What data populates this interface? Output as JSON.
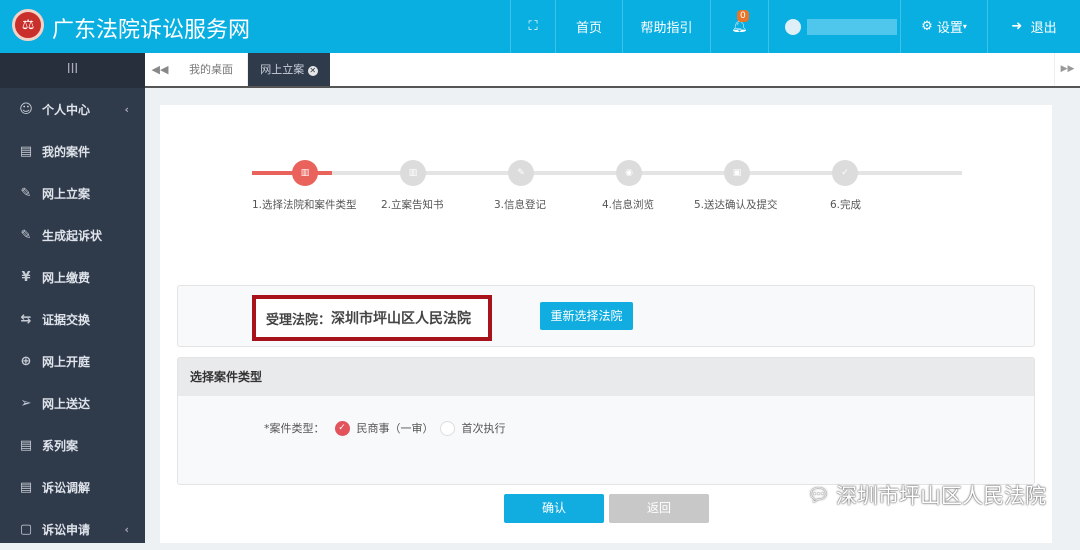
{
  "header": {
    "title": "广东法院诉讼服务网",
    "nav": {
      "home": "首页",
      "help": "帮助指引",
      "notifications_count": "0",
      "settings": "设置",
      "logout": "退出"
    }
  },
  "sidebar": {
    "toggle": "III",
    "items": [
      {
        "label": "个人中心",
        "icon": "user-circle-icon"
      },
      {
        "label": "我的案件",
        "icon": "file-icon"
      },
      {
        "label": "网上立案",
        "icon": "edit-icon"
      },
      {
        "label": "生成起诉状",
        "icon": "edit-icon"
      },
      {
        "label": "网上缴费",
        "icon": "yen-icon"
      },
      {
        "label": "证据交换",
        "icon": "exchange-icon"
      },
      {
        "label": "网上开庭",
        "icon": "globe-icon"
      },
      {
        "label": "网上送达",
        "icon": "send-icon"
      },
      {
        "label": "系列案",
        "icon": "file-icon"
      },
      {
        "label": "诉讼调解",
        "icon": "file-icon"
      },
      {
        "label": "诉讼申请",
        "icon": "file-icon"
      }
    ]
  },
  "tabs": [
    {
      "label": "我的桌面"
    },
    {
      "label": "网上立案",
      "active": true
    }
  ],
  "steps": [
    "1.选择法院和案件类型",
    "2.立案告知书",
    "3.信息登记",
    "4.信息浏览",
    "5.送达确认及提交",
    "6.完成"
  ],
  "current_step": 1,
  "court": {
    "label": "受理法院：",
    "value": "深圳市坪山区人民法院",
    "reselect_button": "重新选择法院"
  },
  "case_type": {
    "heading": "选择案件类型",
    "field_label": "*案件类型：",
    "options": [
      {
        "label": "民商事（一审）",
        "checked": true
      },
      {
        "label": "首次执行",
        "checked": false
      }
    ]
  },
  "actions": {
    "confirm": "确认",
    "back": "返回"
  },
  "watermark": "深圳市坪山区人民法院",
  "colors": {
    "header": "#0aafe2",
    "sidebar": "#2f3a4b",
    "step_active": "#e9625c",
    "highlight_box": "#a8121a"
  }
}
